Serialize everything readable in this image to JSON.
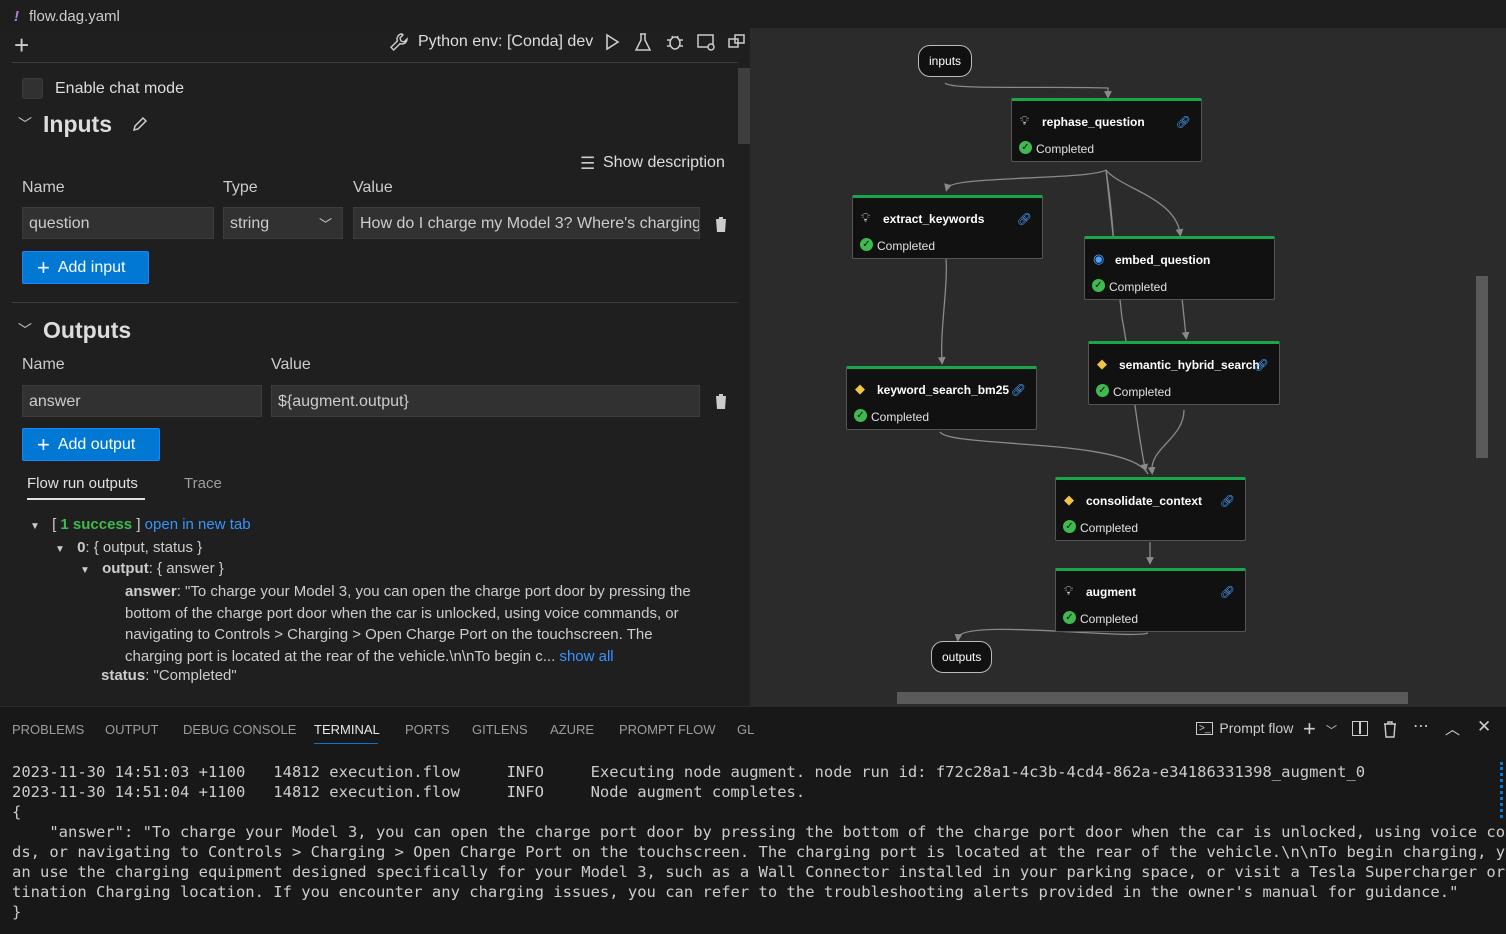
{
  "tab": {
    "icon": "!",
    "title": "flow.dag.yaml"
  },
  "toolbar": {
    "env_label": "Python env: [Conda] dev"
  },
  "chat_mode_label": "Enable chat mode",
  "inputs": {
    "heading": "Inputs",
    "show_description": "Show description",
    "col_name": "Name",
    "col_type": "Type",
    "col_value": "Value",
    "row": {
      "name": "question",
      "type": "string",
      "value": "How do I charge my Model 3? Where's charging"
    },
    "add_label": "Add input"
  },
  "outputs": {
    "heading": "Outputs",
    "col_name": "Name",
    "col_value": "Value",
    "row": {
      "name": "answer",
      "value": "${augment.output}"
    },
    "add_label": "Add output"
  },
  "run_tabs": {
    "active": "Flow run outputs",
    "other": "Trace"
  },
  "tree": {
    "open_bracket": "[",
    "success_count": "1 success",
    "close_bracket": "]",
    "open_link": "open in new tab",
    "item_key": "0",
    "item_summary": ": { output, status }",
    "output_key": "output",
    "output_summary": ": { answer }",
    "answer_key": "answer",
    "answer_line1": ": \"To charge your Model 3, you can open the charge port door by pressing the",
    "answer_line2": "bottom of the charge port door when the car is unlocked, using voice commands, or",
    "answer_line3": "navigating to Controls > Charging > Open Charge Port on the touchscreen. The",
    "answer_line4": "charging port is located at the rear of the vehicle.\\n\\nTo begin c...",
    "show_all": "show all",
    "status_key": "status",
    "status_value": ": \"Completed\""
  },
  "graph": {
    "inputs_label": "inputs",
    "outputs_label": "outputs",
    "nodes": [
      {
        "title": "rephase_question",
        "status": "Completed",
        "icon": "lightbulb-icon"
      },
      {
        "title": "extract_keywords",
        "status": "Completed",
        "icon": "lightbulb-icon"
      },
      {
        "title": "embed_question",
        "status": "Completed",
        "icon": "embedding-icon"
      },
      {
        "title": "keyword_search_bm25",
        "status": "Completed",
        "icon": "python-icon"
      },
      {
        "title": "semantic_hybrid_search",
        "status": "Completed",
        "icon": "python-icon"
      },
      {
        "title": "consolidate_context",
        "status": "Completed",
        "icon": "python-icon"
      },
      {
        "title": "augment",
        "status": "Completed",
        "icon": "lightbulb-icon"
      }
    ],
    "edge_color": "#8a8a8a",
    "completed_color": "#19a64a"
  },
  "panel": {
    "tabs": [
      "PROBLEMS",
      "OUTPUT",
      "DEBUG CONSOLE",
      "TERMINAL",
      "PORTS",
      "GITLENS",
      "AZURE",
      "PROMPT FLOW",
      "GL"
    ],
    "active_tab": "TERMINAL",
    "terminal_name": "Prompt flow"
  },
  "terminal": {
    "lines": [
      "2023-11-30 14:51:03 +1100   14812 execution.flow     INFO     Executing node augment. node run id: f72c28a1-4c3b-4cd4-862a-e34186331398_augment_0",
      "2023-11-30 14:51:04 +1100   14812 execution.flow     INFO     Node augment completes.",
      "{",
      "    \"answer\": \"To charge your Model 3, you can open the charge port door by pressing the bottom of the charge port door when the car is unlocked, using voice comman",
      "ds, or navigating to Controls > Charging > Open Charge Port on the touchscreen. The charging port is located at the rear of the vehicle.\\n\\nTo begin charging, you c",
      "an use the charging equipment designed specifically for your Model 3, such as a Wall Connector installed in your parking space, or visit a Tesla Supercharger or Des",
      "tination Charging location. If you encounter any charging issues, you can refer to the troubleshooting alerts provided in the owner's manual for guidance.\"",
      "}"
    ]
  },
  "colors": {
    "accent": "#0078d4",
    "success": "#3fb950",
    "link": "#3794ff"
  }
}
